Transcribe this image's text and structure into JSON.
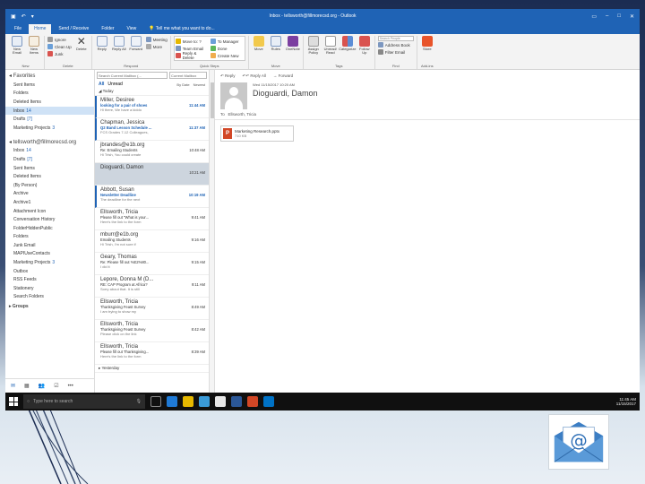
{
  "window": {
    "title": "Inbox - tellsworth@fillmorecsd.org - Outlook"
  },
  "tabs": [
    "File",
    "Home",
    "Send / Receive",
    "Folder",
    "View"
  ],
  "tell_me": "Tell me what you want to do...",
  "ribbon": {
    "groups": [
      {
        "label": "New",
        "buttons": [
          "New Email",
          "New Items"
        ]
      },
      {
        "label": "Delete",
        "small": [
          "Ignore",
          "Clean Up",
          "Junk"
        ],
        "buttons": [
          "Delete"
        ]
      },
      {
        "label": "Respond",
        "buttons": [
          "Reply",
          "Reply All",
          "Forward"
        ],
        "small": [
          "Meeting",
          "More"
        ]
      },
      {
        "label": "Quick Steps",
        "steps": [
          "Move to: ?",
          "To Manager",
          "Team Email",
          "Done",
          "Reply & Delete",
          "Create New"
        ]
      },
      {
        "label": "Move",
        "buttons": [
          "Move",
          "Rules",
          "OneNote"
        ]
      },
      {
        "label": "Tags",
        "buttons": [
          "Assign Policy",
          "Unread/ Read",
          "Categorize",
          "Follow Up"
        ]
      },
      {
        "label": "Find",
        "small": [
          "Search People",
          "Address Book",
          "Filter Email"
        ]
      },
      {
        "label": "Add-ins",
        "buttons": [
          "Store"
        ]
      }
    ]
  },
  "favorites": {
    "header": "Favorites",
    "items": [
      {
        "label": "Sent Items",
        "count": ""
      },
      {
        "label": "Folders",
        "count": ""
      },
      {
        "label": "Deleted Items",
        "count": ""
      },
      {
        "label": "Inbox",
        "count": "14"
      },
      {
        "label": "Drafts",
        "count": "[7]"
      },
      {
        "label": "Marketing Projects",
        "count": "3"
      }
    ]
  },
  "account": {
    "header": "tellsworth@fillmorecsd.org",
    "items": [
      {
        "label": "Inbox",
        "count": "14"
      },
      {
        "label": "Drafts",
        "count": "[7]"
      },
      {
        "label": "Sent Items",
        "count": ""
      },
      {
        "label": "Deleted Items",
        "count": ""
      },
      {
        "label": "(By Person)",
        "count": ""
      },
      {
        "label": "Archive",
        "count": ""
      },
      {
        "label": "Archive1",
        "count": ""
      },
      {
        "label": "Attachment Icon",
        "count": ""
      },
      {
        "label": "Conversation History",
        "count": ""
      },
      {
        "label": "FolderHiddenPublic",
        "count": ""
      },
      {
        "label": "Folders",
        "count": ""
      },
      {
        "label": "Junk Email",
        "count": ""
      },
      {
        "label": "MAPIUseContacts",
        "count": ""
      },
      {
        "label": "Marketing Projects",
        "count": "3"
      },
      {
        "label": "Outbox",
        "count": ""
      },
      {
        "label": "RSS Feeds",
        "count": ""
      },
      {
        "label": "Stationery",
        "count": ""
      },
      {
        "label": "Search Folders",
        "count": ""
      }
    ],
    "groups_label": "Groups"
  },
  "list": {
    "search_placeholder": "Search Current Mailbox (...",
    "scope": "Current Mailbox",
    "filter_all": "All",
    "filter_unread": "Unread",
    "sort": "By Date",
    "order": "Newest",
    "group_today": "Today",
    "group_yesterday": "Yesterday",
    "messages": [
      {
        "from": "Miller, Desiree",
        "subject": "looking for a pair of shoes",
        "time": "11:44 AM",
        "preview": "Hi there,  We have a kiddo",
        "unread": true
      },
      {
        "from": "Chapman, Jessica",
        "subject": "Q2 Band Lesson Schedule ...",
        "time": "11:37 AM",
        "preview": "FCS Grades 7-12 Colleagues,",
        "unread": true
      },
      {
        "from": "jbrandes@e1b.org",
        "subject": "Re: Emailing Students",
        "time": "10:48 AM",
        "preview": "Hi Trish,  You could create",
        "unread": false
      },
      {
        "from": "Dioguardi, Damon",
        "subject": "",
        "time": "10:21 AM",
        "preview": "",
        "unread": false
      },
      {
        "from": "Abbott, Susan",
        "subject": "Newsletter Deadline",
        "time": "10:19 AM",
        "preview": "The deadline for the next",
        "unread": true
      },
      {
        "from": "Ellsworth, Tricia",
        "subject": "Please fill out \"What is your...",
        "time": "9:41 AM",
        "preview": "Here's the link to the form",
        "unread": false
      },
      {
        "from": "mburr@e1b.org",
        "subject": "Emailing Students",
        "time": "9:16 AM",
        "preview": "Hi Trish,  I'm not sure if",
        "unread": false
      },
      {
        "from": "Geary, Thomas",
        "subject": "Re: Please fill out %E2%80...",
        "time": "9:15 AM",
        "preview": "I did it",
        "unread": false
      },
      {
        "from": "Lepore, Donna M (D...",
        "subject": "RE: CAP Program at Africa?",
        "time": "9:11 AM",
        "preview": "Sorry about that.   It is still",
        "unread": false
      },
      {
        "from": "Ellsworth, Tricia",
        "subject": "Thanksgiving Feast Survey",
        "time": "8:49 AM",
        "preview": "I am trying to show my",
        "unread": false
      },
      {
        "from": "Ellsworth, Tricia",
        "subject": "Thanksgiving Feast Survey",
        "time": "8:42 AM",
        "preview": "Please click on the link",
        "unread": false
      },
      {
        "from": "Ellsworth, Tricia",
        "subject": "Please fill out Thanksgiving...",
        "time": "8:39 AM",
        "preview": "Here's the link to the form",
        "unread": false
      }
    ]
  },
  "reading": {
    "actions": [
      "Reply",
      "Reply All",
      "Forward"
    ],
    "date": "Wed 11/15/2017 10:20 AM",
    "sender": "Dioguardi, Damon",
    "to_label": "To",
    "to": "Ellsworth, Tricia",
    "attachment_name": "Marketing Research.pptx",
    "attachment_size": "710 KB"
  },
  "status": {
    "items": "Items: 370",
    "unread": "Unread: 14",
    "sync": "All folders are up to date.",
    "connection": "Connected to: Microsoft Exchange",
    "zoom": "100%"
  },
  "taskbar": {
    "search_placeholder": "Type here to search",
    "time": "11:45 AM",
    "date": "11/15/2017"
  }
}
